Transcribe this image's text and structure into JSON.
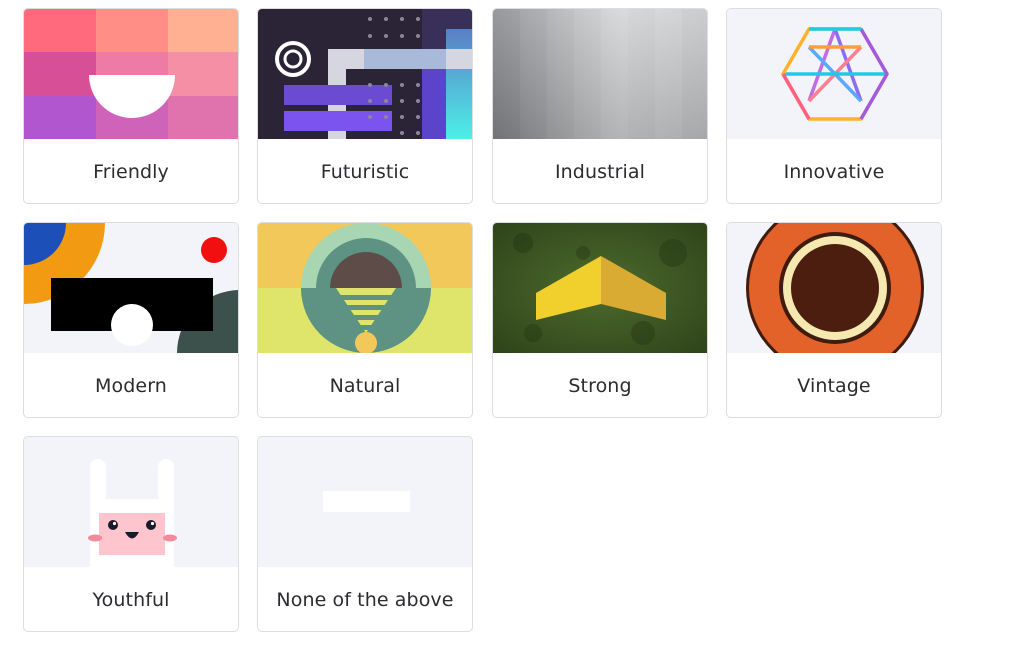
{
  "styles": [
    {
      "id": "friendly",
      "label": "Friendly",
      "icon": "friendly-art-icon"
    },
    {
      "id": "futuristic",
      "label": "Futuristic",
      "icon": "futuristic-art-icon"
    },
    {
      "id": "industrial",
      "label": "Industrial",
      "icon": "industrial-art-icon"
    },
    {
      "id": "innovative",
      "label": "Innovative",
      "icon": "innovative-art-icon"
    },
    {
      "id": "modern",
      "label": "Modern",
      "icon": "modern-art-icon"
    },
    {
      "id": "natural",
      "label": "Natural",
      "icon": "natural-art-icon"
    },
    {
      "id": "strong",
      "label": "Strong",
      "icon": "strong-art-icon"
    },
    {
      "id": "vintage",
      "label": "Vintage",
      "icon": "vintage-art-icon"
    },
    {
      "id": "youthful",
      "label": "Youthful",
      "icon": "youthful-art-icon"
    },
    {
      "id": "none",
      "label": "None of the above",
      "icon": "blank-art-icon"
    }
  ]
}
